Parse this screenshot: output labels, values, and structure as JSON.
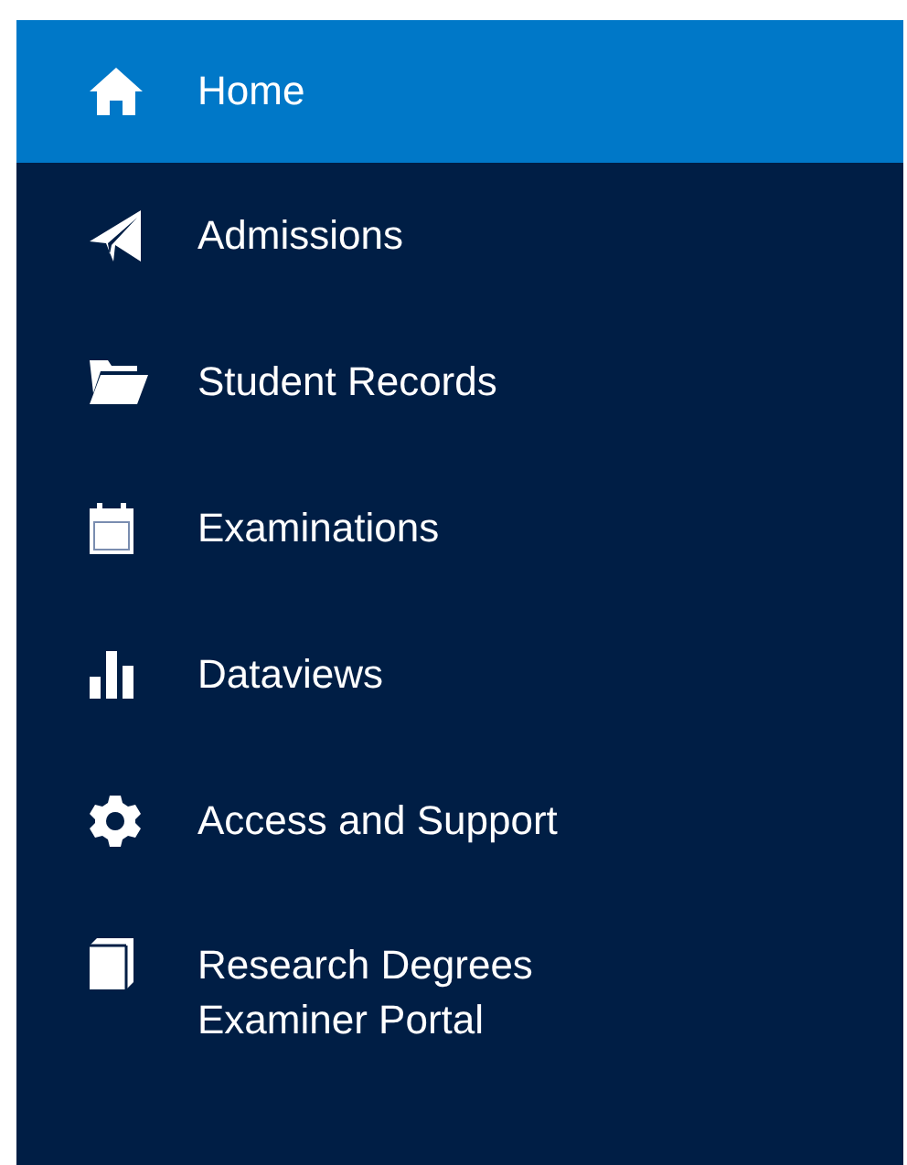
{
  "nav": {
    "items": [
      {
        "label": "Home",
        "selected": true
      },
      {
        "label": "Admissions",
        "selected": false
      },
      {
        "label": "Student Records",
        "selected": false
      },
      {
        "label": "Examinations",
        "selected": false
      },
      {
        "label": "Dataviews",
        "selected": false
      },
      {
        "label": "Access and Support",
        "selected": false
      },
      {
        "label": "Research Degrees Examiner Portal",
        "selected": false
      }
    ]
  }
}
